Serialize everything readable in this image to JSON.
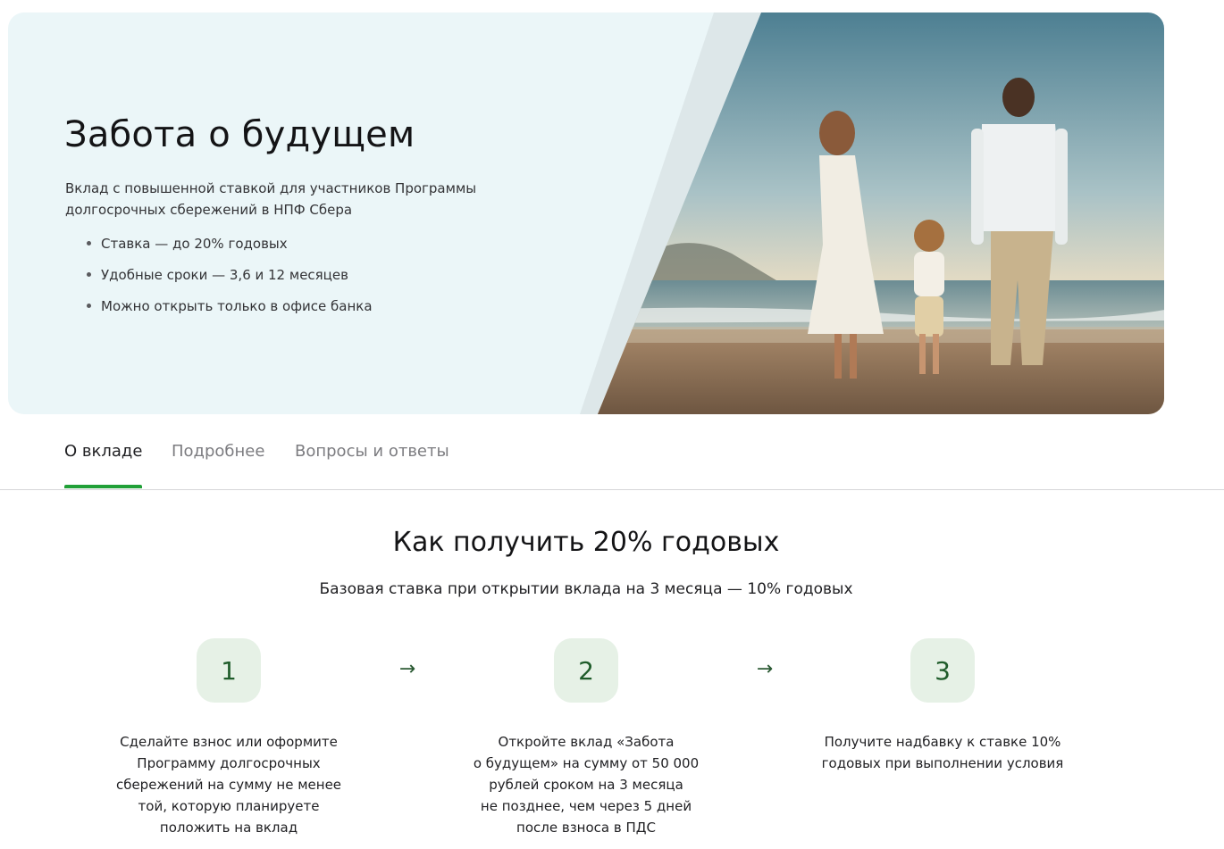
{
  "hero": {
    "title": "Забота о будущем",
    "description": "Вклад с повышенной ставкой для участников Программы долгосрочных сбережений в НПФ Сбера",
    "features": [
      "Ставка — до 20% годовых",
      "Удобные сроки — 3,6 и 12 месяцев",
      "Можно открыть только в офисе банка"
    ],
    "background_color": "#ebf6f8"
  },
  "tabs": [
    {
      "label": "О вкладе",
      "active": true
    },
    {
      "label": "Подробнее",
      "active": false
    },
    {
      "label": "Вопросы и ответы",
      "active": false
    }
  ],
  "accent_color": "#21a038",
  "how_to": {
    "title": "Как получить 20% годовых",
    "subtitle": "Базовая ставка при открытии вклада на 3 месяца — 10% годовых",
    "arrow_icon": "arrow-right-icon",
    "steps": [
      {
        "number": "1",
        "text": "Сделайте взнос или оформите\nПрограмму долгосрочных\nсбережений на сумму не менее\nтой, которую планируете\nположить на вклад"
      },
      {
        "number": "2",
        "text": "Откройте вклад «Забота\nо будущем» на сумму от 50 000\nрублей сроком на 3 месяца\nне позднее, чем через 5 дней\nпосле взноса в ПДС"
      },
      {
        "number": "3",
        "text": "Получите надбавку к ставке 10%\nгодовых при выполнении условия"
      }
    ]
  }
}
